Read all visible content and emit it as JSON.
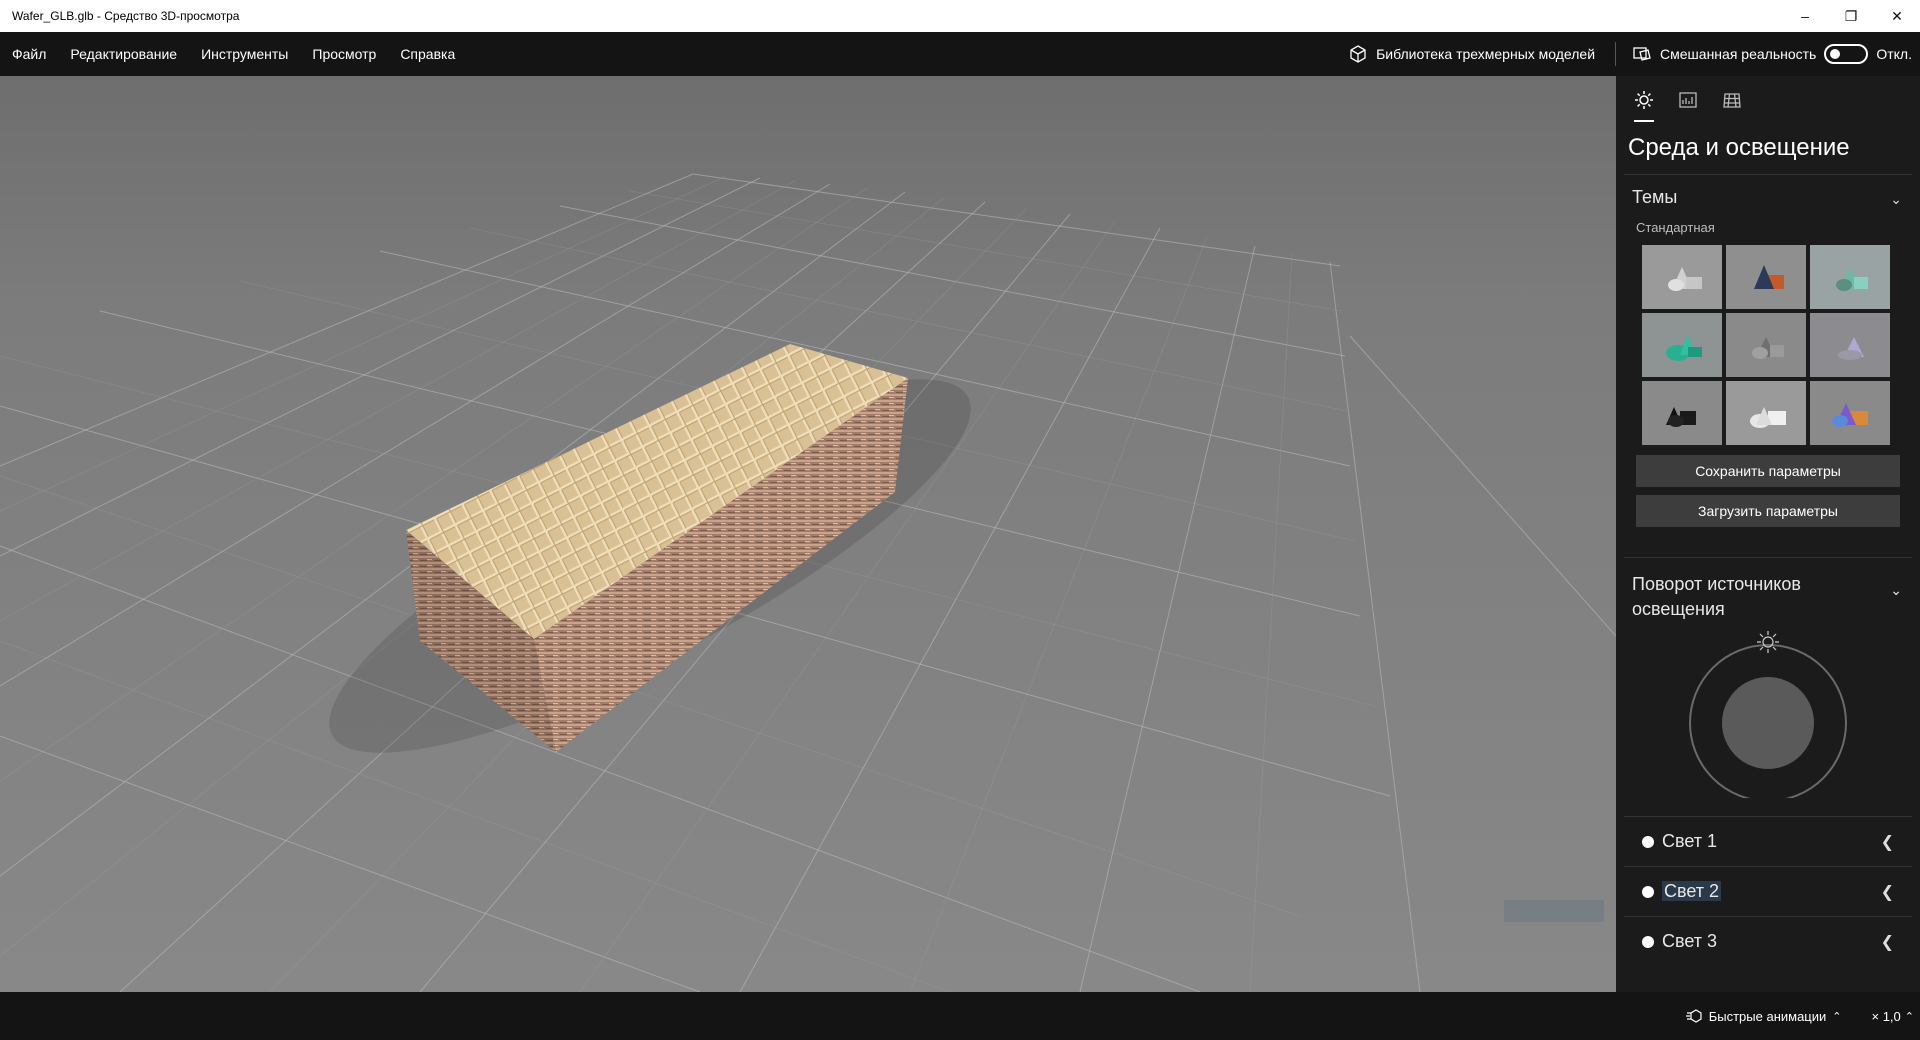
{
  "window": {
    "title": "Wafer_GLB.glb - Средство 3D-просмотра"
  },
  "menu": {
    "items": [
      "Файл",
      "Редактирование",
      "Инструменты",
      "Просмотр",
      "Справка"
    ],
    "library_label": "Библиотека трехмерных моделей",
    "mixed_reality_label": "Смешанная реальность",
    "mixed_reality_state": "Откл."
  },
  "panel": {
    "tab_icons": [
      "sun-icon",
      "stats-icon",
      "grid-icon"
    ],
    "title": "Среда и освещение",
    "themes": {
      "heading": "Темы",
      "subheading": "Стандартная",
      "selected_index": 0
    },
    "save_label": "Сохранить параметры",
    "load_label": "Загрузить параметры",
    "rotation_heading": "Поворот источников освещения",
    "lights": [
      "Свет 1",
      "Свет 2",
      "Свет 3"
    ]
  },
  "statusbar": {
    "animations_label": "Быстрые анимации",
    "speed": "× 1,0"
  },
  "colors": {
    "accent": "#ffffff",
    "panel_bg": "#1b1b1b",
    "viewport_bg": "#7a7a7a"
  }
}
